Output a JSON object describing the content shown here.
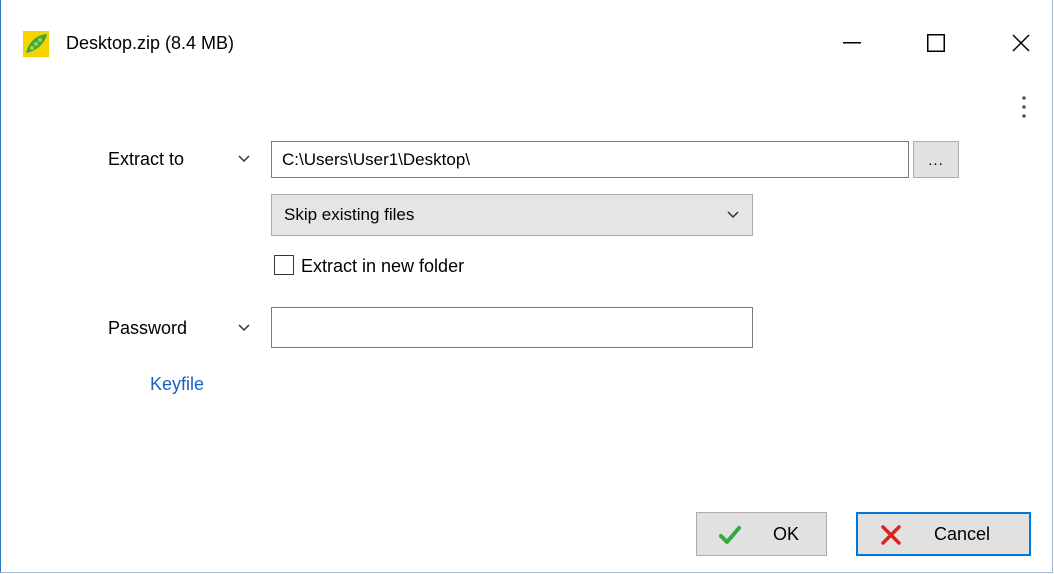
{
  "window": {
    "title": "Desktop.zip (8.4 MB)",
    "icon": "peapod-app-icon"
  },
  "controls": {
    "minimize": "minimize-icon",
    "maximize": "maximize-icon",
    "close": "close-icon",
    "menu": "kebab-menu-icon"
  },
  "extract": {
    "label": "Extract to",
    "path": "C:\\Users\\User1\\Desktop\\",
    "browse_label": "...",
    "mode_selected": "Skip existing files",
    "new_folder_label": "Extract in new folder",
    "new_folder_checked": false
  },
  "password": {
    "label": "Password",
    "value": ""
  },
  "keyfile": {
    "label": "Keyfile",
    "color": "#1a5fc8"
  },
  "buttons": {
    "ok_label": "OK",
    "cancel_label": "Cancel",
    "ok_color": "#2eaa3e",
    "cancel_color": "#d9261c",
    "focus_color": "#0078d7"
  }
}
